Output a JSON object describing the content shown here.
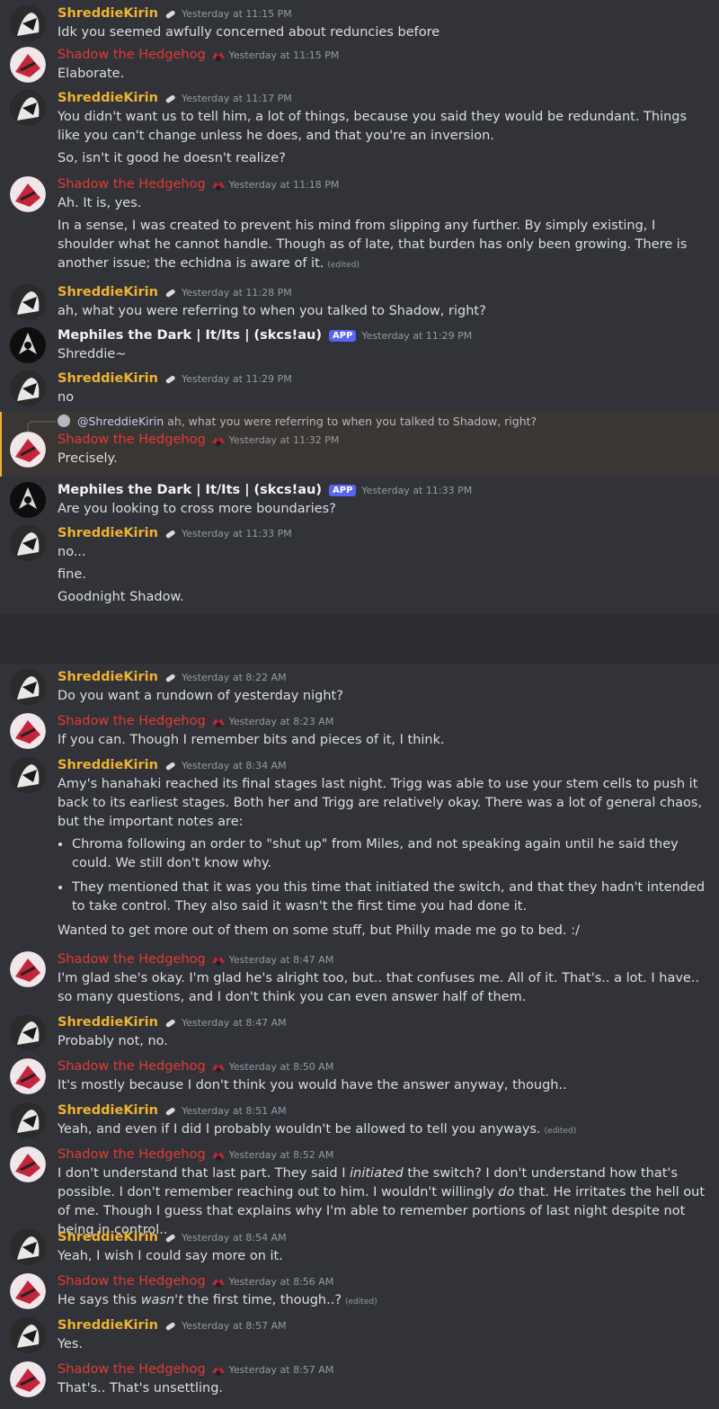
{
  "users": {
    "kirin": "ShreddieKirin",
    "shadow": "Shadow the Hedgehog",
    "meph": "Mephiles the Dark | It/Its | (skcs!au)"
  },
  "app_tag": "APP",
  "edited_label": "(edited)",
  "icons": {
    "kirin": "pill-icon",
    "shadow": "hedgehog-head-icon",
    "avatar_badge": "crown-icon"
  },
  "colors": {
    "kirin": "#f0b232",
    "shadow": "#e23b32",
    "meph": "#f2f3f5",
    "app": "#5865f2",
    "highlight": "#f0b232"
  },
  "block1": [
    {
      "user": "kirin",
      "time": "Yesterday at 11:15 PM",
      "lines": [
        "Idk you seemed awfully concerned about reduncies before"
      ]
    },
    {
      "user": "shadow",
      "time": "Yesterday at 11:15 PM",
      "lines": [
        "Elaborate."
      ]
    },
    {
      "user": "kirin",
      "time": "Yesterday at 11:17 PM",
      "lines": [
        "You didn't want us to tell him, a lot of things, because you said they would be redundant. Things like you can't change unless he does, and that you're an inversion.",
        "So, isn't it good he doesn't realize?"
      ]
    },
    {
      "user": "shadow",
      "time": "Yesterday at 11:18 PM",
      "lines": [
        "Ah. It is, yes.",
        "In a sense, I was created to prevent his mind from slipping any further. By simply existing, I shoulder what he cannot handle. Though as of late, that burden has only been growing. There is another issue; the echidna is aware of it."
      ]
    },
    {
      "user": "kirin",
      "time": "Yesterday at 11:28 PM",
      "lines": [
        "ah, what you were referring to when you talked to Shadow, right?"
      ]
    },
    {
      "user": "meph",
      "time": "Yesterday at 11:29 PM",
      "lines": [
        "Shreddie~"
      ]
    },
    {
      "user": "kirin",
      "time": "Yesterday at 11:29 PM",
      "lines": [
        "no"
      ]
    },
    {
      "user": "shadow",
      "time": "Yesterday at 11:32 PM",
      "lines": [
        "Precisely."
      ],
      "reply_mention": "@ShreddieKirin",
      "reply_text": "ah, what you were referring to when you talked to Shadow, right?"
    },
    {
      "user": "meph",
      "time": "Yesterday at 11:33 PM",
      "lines": [
        "Are you looking to cross more boundaries?"
      ]
    },
    {
      "user": "kirin",
      "time": "Yesterday at 11:33 PM",
      "lines": [
        "no...",
        "fine.",
        "Goodnight Shadow."
      ]
    }
  ],
  "block2": [
    {
      "user": "kirin",
      "time": "Yesterday at 8:22 AM",
      "lines": [
        "Do you want a rundown of yesterday night?"
      ]
    },
    {
      "user": "shadow",
      "time": "Yesterday at 8:23 AM",
      "lines": [
        "If you can. Though I remember bits and pieces of it, I think."
      ]
    },
    {
      "user": "kirin",
      "time": "Yesterday at 8:34 AM",
      "lines": [
        "Amy's hanahaki reached its final stages last night. Trigg was able to use your stem cells to push it back to its earliest stages. Both her and Trigg are relatively okay. There was a lot of general chaos, but the important notes are:"
      ],
      "bullets": [
        "Chroma following an order to \"shut up\" from Miles, and not speaking again until he said they could. We still don't know why.",
        "They mentioned that it was you this time that initiated the switch, and that they hadn't intended to take control. They also said it wasn't the first time you had done it."
      ],
      "after": "Wanted to get more out of them on some stuff, but Philly made me go to bed. :/"
    },
    {
      "user": "shadow",
      "time": "Yesterday at 8:47 AM",
      "lines": [
        "I'm glad she's okay. I'm glad he's alright too, but.. that confuses me. All of it. That's.. a lot. I have.. so many questions, and I don't think you can even answer half of them."
      ]
    },
    {
      "user": "kirin",
      "time": "Yesterday at 8:47 AM",
      "lines": [
        "Probably not, no."
      ]
    },
    {
      "user": "shadow",
      "time": "Yesterday at 8:50 AM",
      "lines": [
        "It's mostly because I don't think you would have the answer anyway, though.."
      ]
    },
    {
      "user": "kirin",
      "time": "Yesterday at 8:51 AM",
      "lines": [
        "Yeah, and even if I did I probably wouldn't be allowed to tell you anyways."
      ]
    },
    {
      "user": "shadow",
      "time": "Yesterday at 8:52 AM",
      "parts": [
        {
          "t": "I don't understand that last part. They said I "
        },
        {
          "t": "initiated",
          "i": true
        },
        {
          "t": " the switch? I don't understand how that's possible. I don't remember reaching out to him. I wouldn't willingly "
        },
        {
          "t": "do",
          "i": true
        },
        {
          "t": " that. He irritates the hell out of me. Though I guess that explains why I'm able to remember portions of last night despite not being in control.."
        }
      ]
    },
    {
      "user": "kirin",
      "time": "Yesterday at 8:54 AM",
      "lines": [
        "Yeah, I wish I could say more on it."
      ]
    },
    {
      "user": "shadow",
      "time": "Yesterday at 8:56 AM",
      "parts": [
        {
          "t": "He says this "
        },
        {
          "t": "wasn't",
          "i": true
        },
        {
          "t": " the first time, though..?"
        }
      ]
    },
    {
      "user": "kirin",
      "time": "Yesterday at 8:57 AM",
      "lines": [
        "Yes."
      ]
    },
    {
      "user": "shadow",
      "time": "Yesterday at 8:57 AM",
      "lines": [
        "That's.. That's unsettling."
      ]
    }
  ]
}
